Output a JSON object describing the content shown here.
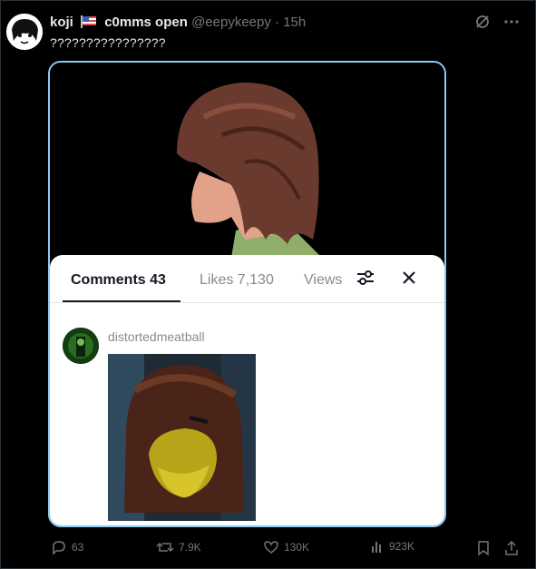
{
  "tweet": {
    "display_name": "koji",
    "display_name_suffix": "c0mms open",
    "handle": "@eepykeepy",
    "separator": "·",
    "time": "15h",
    "text": "????????????????"
  },
  "sheet": {
    "tabs": [
      {
        "label": "Comments 43",
        "active": true
      },
      {
        "label": "Likes 7,130",
        "active": false
      },
      {
        "label": "Views",
        "active": false
      }
    ]
  },
  "comment": {
    "username": "distortedmeatball"
  },
  "actions": {
    "replies": "63",
    "reposts": "7.9K",
    "likes": "130K",
    "views": "923K"
  },
  "colors": {
    "background": "#000000",
    "media_border": "#8ecaf0",
    "muted_text": "#71767b"
  }
}
